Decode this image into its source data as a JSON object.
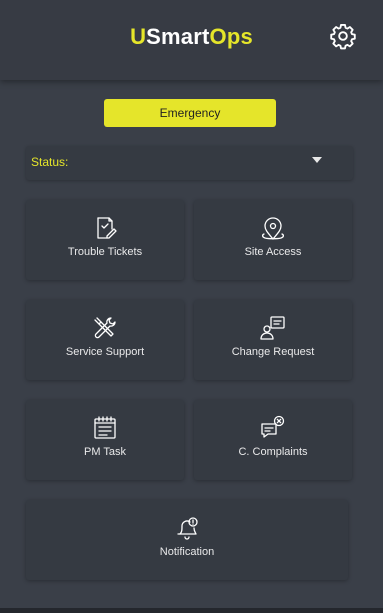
{
  "header": {
    "logo_part1": "U",
    "logo_part2": "Smart",
    "logo_part3": "Ops",
    "settings_icon": "gear-icon"
  },
  "emergency_button": "Emergency",
  "status": {
    "label": "Status:",
    "value": ""
  },
  "tiles": [
    {
      "label": "Trouble Tickets",
      "icon": "ticket-icon"
    },
    {
      "label": "Site Access",
      "icon": "location-pin-icon"
    },
    {
      "label": "Service Support",
      "icon": "tools-icon"
    },
    {
      "label": "Change Request",
      "icon": "change-request-icon"
    },
    {
      "label": "PM Task",
      "icon": "task-list-icon"
    },
    {
      "label": "C. Complaints",
      "icon": "complaint-chat-icon"
    },
    {
      "label": "Notification",
      "icon": "bell-icon"
    }
  ],
  "colors": {
    "accent": "#e5e52a",
    "background": "#3a3f48",
    "tile": "#353a42",
    "text": "#e9e9ea"
  }
}
